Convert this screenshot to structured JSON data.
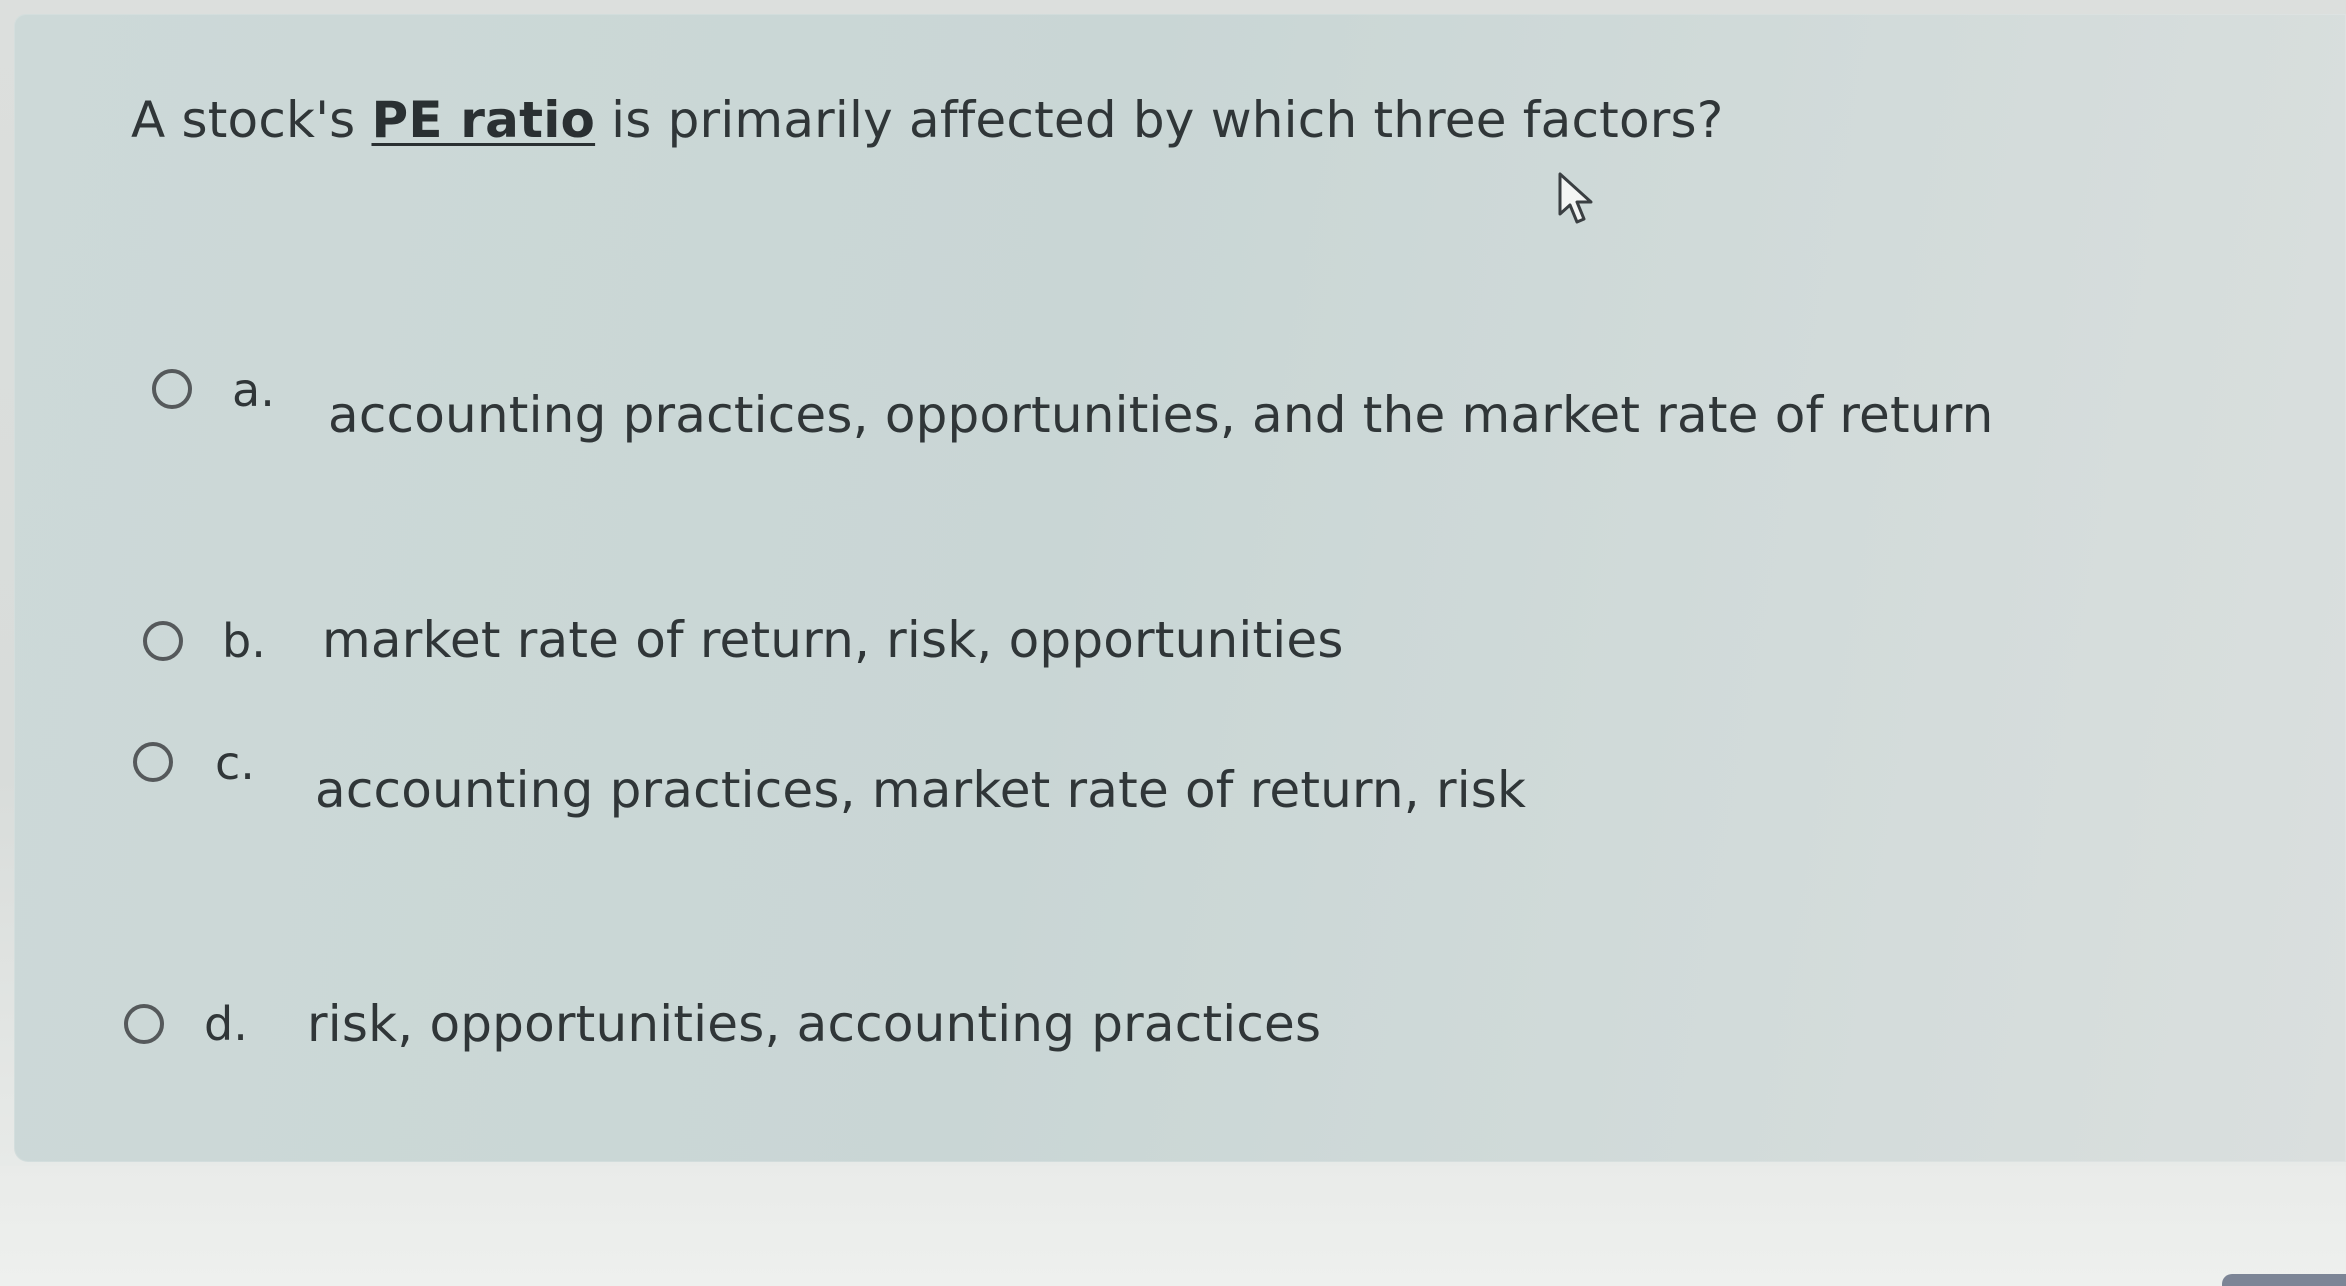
{
  "question": {
    "prefix": "A stock's ",
    "term": "PE ratio",
    "suffix": " is primarily affected by which three factors?"
  },
  "cursor_icon": "arrow-pointer-icon",
  "options": [
    {
      "letter": "a.",
      "text": "accounting practices, opportunities, and the market rate of return",
      "selected": false
    },
    {
      "letter": "b.",
      "text": "market rate of return, risk, opportunities",
      "selected": false
    },
    {
      "letter": "c.",
      "text": "accounting practices, market rate of return, risk",
      "selected": false
    },
    {
      "letter": "d.",
      "text": "risk, opportunities, accounting practices",
      "selected": false
    }
  ]
}
